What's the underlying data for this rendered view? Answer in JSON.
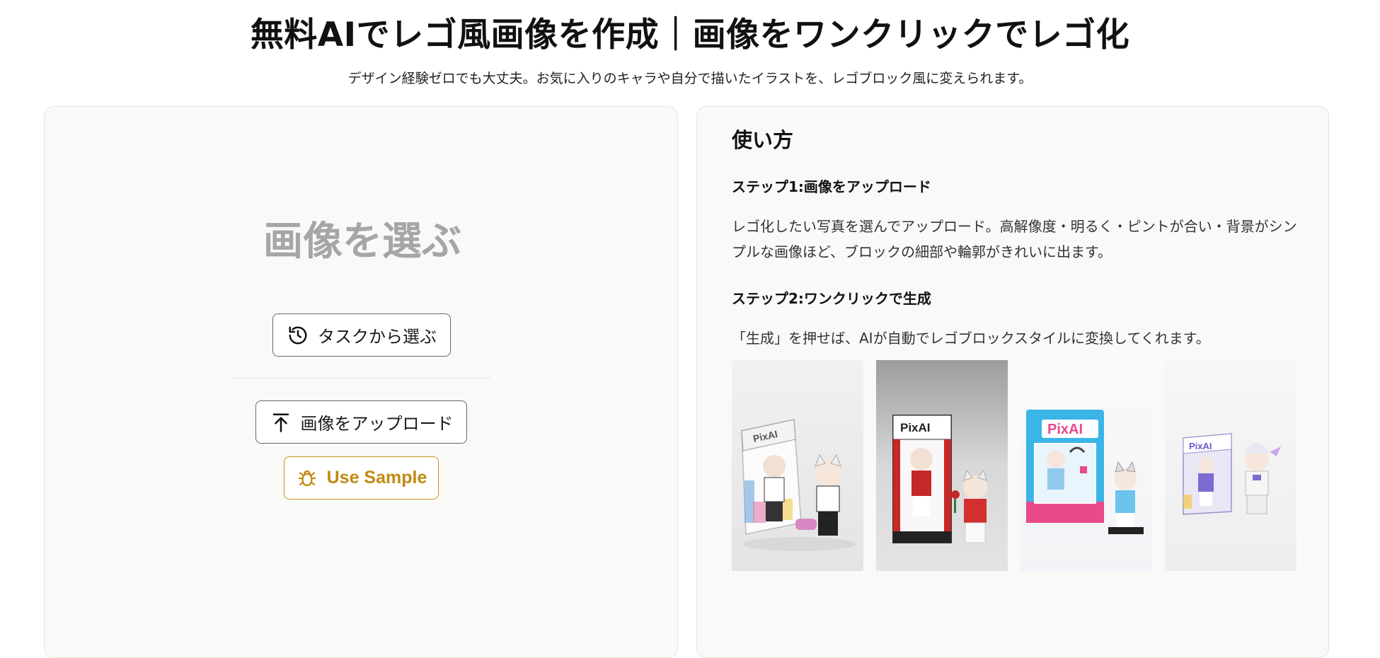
{
  "header": {
    "title": "無料AIでレゴ風画像を作成｜画像をワンクリックでレゴ化",
    "subtitle": "デザイン経験ゼロでも大丈夫。お気に入りのキャラや自分で描いたイラストを、レゴブロック風に変えられます。"
  },
  "left_panel": {
    "choose_title": "画像を選ぶ",
    "task_button_label": "タスクから選ぶ",
    "upload_button_label": "画像をアップロード",
    "sample_button_label": "Use Sample",
    "icons": {
      "task": "history-icon",
      "upload": "upload-arrow-icon",
      "sample": "bug-icon"
    },
    "colors": {
      "sample_accent": "#c9941a",
      "choose_title": "#a6a6a6"
    }
  },
  "right_panel": {
    "heading": "使い方",
    "steps": [
      {
        "title": "ステップ1:画像をアップロード",
        "description": "レゴ化したい写真を選んでアップロード。高解像度・明るく・ピントが合い・背景がシンプルな画像ほど、ブロックの細部や輪郭がきれいに出ます。"
      },
      {
        "title": "ステップ2:ワンクリックで生成",
        "description": "「生成」を押せば、AIが自動でレゴブロックスタイルに変換してくれます。"
      }
    ],
    "sample_images": [
      {
        "name": "lego-figure-box-sample-1",
        "box_label": "PixAI"
      },
      {
        "name": "lego-figure-box-sample-2",
        "box_label": "PixAI"
      },
      {
        "name": "lego-figure-box-sample-3",
        "box_label": "PixAI"
      },
      {
        "name": "lego-figure-box-sample-4",
        "box_label": "PixAI"
      }
    ]
  }
}
